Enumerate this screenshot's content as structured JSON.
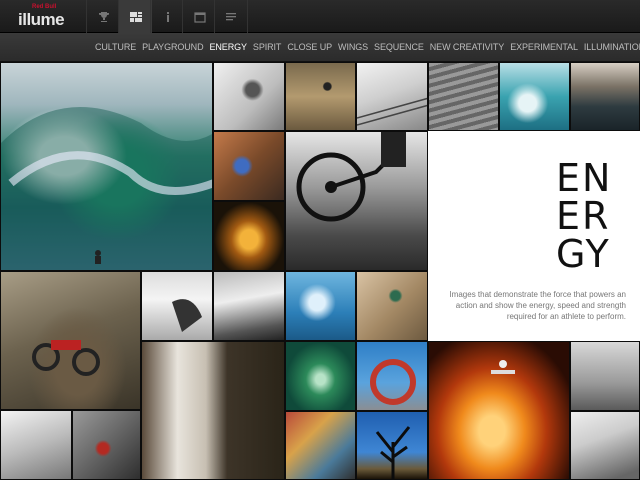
{
  "header": {
    "logo_brand": "Red Bull",
    "logo_word": "illume",
    "buttons": [
      {
        "icon": "trophy-icon"
      },
      {
        "icon": "grid-view-icon",
        "active": true
      },
      {
        "icon": "info-icon"
      },
      {
        "icon": "calendar-icon"
      },
      {
        "icon": "list-icon"
      }
    ]
  },
  "nav": {
    "items": [
      {
        "label": "CULTURE"
      },
      {
        "label": "PLAYGROUND"
      },
      {
        "label": "ENERGY",
        "active": true
      },
      {
        "label": "SPIRIT"
      },
      {
        "label": "CLOSE UP"
      },
      {
        "label": "WINGS"
      },
      {
        "label": "SEQUENCE"
      },
      {
        "label": "NEW CREATIVITY"
      },
      {
        "label": "EXPERIMENTAL"
      },
      {
        "label": "ILLUMINATION"
      }
    ]
  },
  "panel": {
    "title_lines": [
      "EN",
      "ER",
      "GY"
    ],
    "description": "Images that demonstrate the force that powers an action and show the energy, speed and strength required for an athlete to perform."
  }
}
